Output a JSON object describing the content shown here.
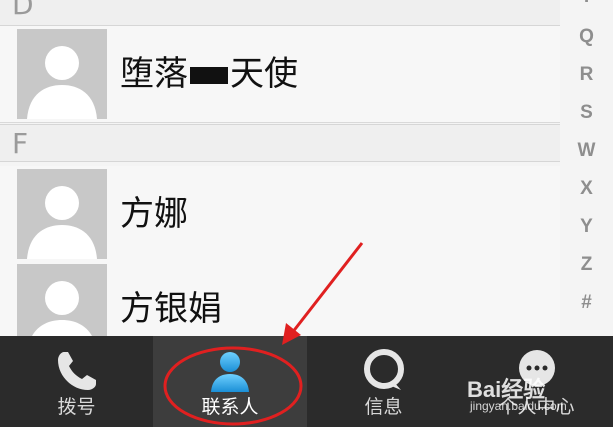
{
  "sections": [
    {
      "letter": "D",
      "contacts": [
        "堕落",
        "天使"
      ]
    },
    {
      "letter": "F",
      "contacts": [
        "方娜",
        "方银娟"
      ]
    }
  ],
  "contact_row1": {
    "name_part1": "堕落",
    "name_part2": "天使"
  },
  "contact_row2": {
    "name": "方娜"
  },
  "contact_row3": {
    "name": "方银娟"
  },
  "index_letters": [
    "T",
    "Q",
    "R",
    "S",
    "W",
    "X",
    "Y",
    "Z",
    "#"
  ],
  "tabs": [
    {
      "id": "dial",
      "label": "拨号",
      "icon": "phone-icon",
      "active": false
    },
    {
      "id": "contacts",
      "label": "联系人",
      "icon": "contact-person-icon",
      "active": true
    },
    {
      "id": "messages",
      "label": "信息",
      "icon": "message-bubble-icon",
      "active": false
    },
    {
      "id": "profile",
      "label": "个人中心",
      "icon": "chat-dots-icon",
      "active": false
    }
  ],
  "annotation": {
    "color": "#e02020"
  },
  "watermark": {
    "text": "Bai经验",
    "sub": "jingyan.baidu.com"
  }
}
